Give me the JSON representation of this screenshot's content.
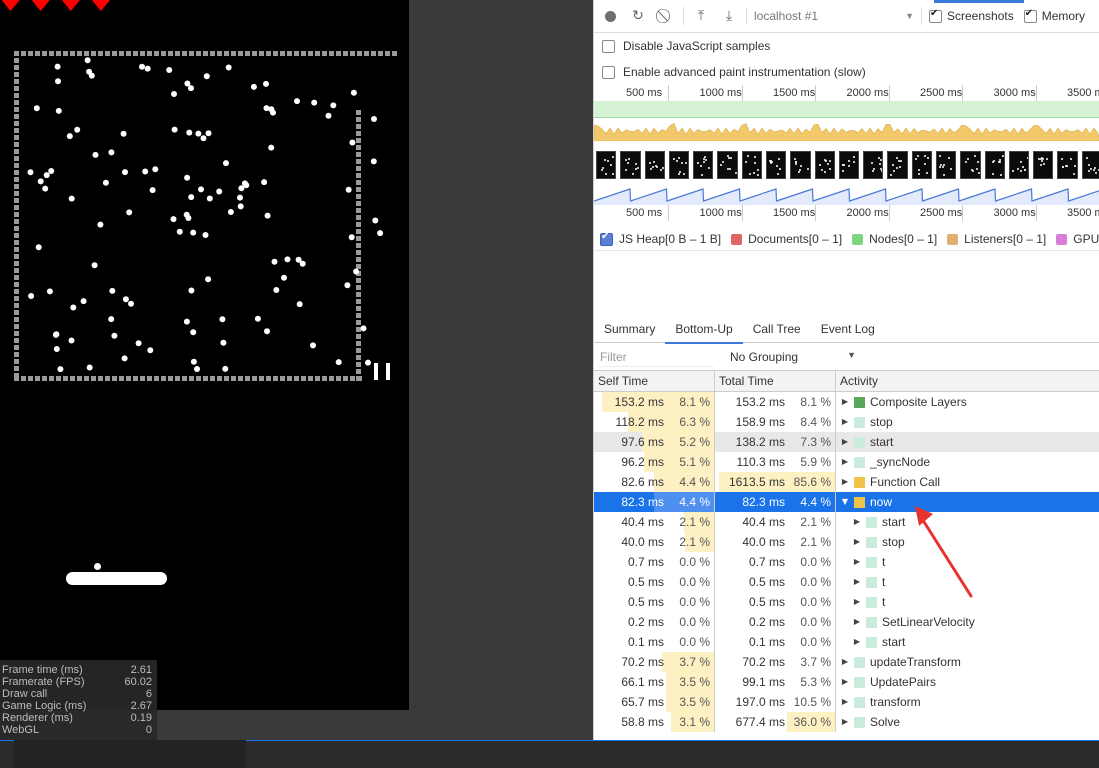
{
  "game": {
    "hearts": [
      "♥",
      "♥",
      "♥",
      "♥"
    ],
    "pause_icon": "pause-icon"
  },
  "stats": [
    {
      "label": "Frame time (ms)",
      "value": "2.61"
    },
    {
      "label": "Framerate (FPS)",
      "value": "60.02"
    },
    {
      "label": "Draw call",
      "value": "6"
    },
    {
      "label": "Game Logic (ms)",
      "value": "2.67"
    },
    {
      "label": "Renderer (ms)",
      "value": "0.19"
    },
    {
      "label": "WebGL",
      "value": "0"
    }
  ],
  "toolbar": {
    "target": "localhost #1",
    "screenshots_label": "Screenshots",
    "memory_label": "Memory"
  },
  "options": {
    "disable_js_samples": "Disable JavaScript samples",
    "advanced_paint": "Enable advanced paint instrumentation (slow)"
  },
  "ruler_labels": [
    "500 ms",
    "1000 ms",
    "1500 ms",
    "2000 ms",
    "2500 ms",
    "3000 ms",
    "3500 ms"
  ],
  "legend": [
    {
      "label": "JS Heap[0 B – 1 B]",
      "color": "#5a7fd6",
      "checked": true
    },
    {
      "label": "Documents[0 – 1]",
      "color": "#e06666",
      "checked": false
    },
    {
      "label": "Nodes[0 – 1]",
      "color": "#7ed67e",
      "checked": false
    },
    {
      "label": "Listeners[0 – 1]",
      "color": "#e0b070",
      "checked": false
    },
    {
      "label": "GPU Memory",
      "color": "#d77ed7",
      "checked": false
    }
  ],
  "tabs": [
    "Summary",
    "Bottom-Up",
    "Call Tree",
    "Event Log"
  ],
  "active_tab": "Bottom-Up",
  "filter": {
    "placeholder": "Filter",
    "grouping": "No Grouping"
  },
  "table": {
    "headers": [
      "Self Time",
      "Total Time",
      "Activity"
    ],
    "rows": [
      {
        "self": "153.2 ms",
        "selfPct": "8.1 %",
        "selfBar": 0.93,
        "total": "153.2 ms",
        "totalPct": "8.1 %",
        "totalBar": 0.0,
        "name": "Composite Layers",
        "color": "#5aa65a",
        "indent": 0,
        "open": false,
        "state": ""
      },
      {
        "self": "118.2 ms",
        "selfPct": "6.3 %",
        "selfBar": 0.72,
        "total": "158.9 ms",
        "totalPct": "8.4 %",
        "totalBar": 0.0,
        "name": "stop",
        "color": "#c9ecdc",
        "indent": 0,
        "open": false,
        "state": ""
      },
      {
        "self": "97.6 ms",
        "selfPct": "5.2 %",
        "selfBar": 0.6,
        "total": "138.2 ms",
        "totalPct": "7.3 %",
        "totalBar": 0.0,
        "name": "start",
        "color": "#c9ecdc",
        "indent": 0,
        "open": false,
        "state": "hover"
      },
      {
        "self": "96.2 ms",
        "selfPct": "5.1 %",
        "selfBar": 0.58,
        "total": "110.3 ms",
        "totalPct": "5.9 %",
        "totalBar": 0.0,
        "name": "_syncNode",
        "color": "#c9ecdc",
        "indent": 0,
        "open": false,
        "state": ""
      },
      {
        "self": "82.6 ms",
        "selfPct": "4.4 %",
        "selfBar": 0.5,
        "total": "1613.5 ms",
        "totalPct": "85.6 %",
        "totalBar": 0.97,
        "name": "Function Call",
        "color": "#f0c24a",
        "indent": 0,
        "open": false,
        "state": ""
      },
      {
        "self": "82.3 ms",
        "selfPct": "4.4 %",
        "selfBar": 0.5,
        "total": "82.3 ms",
        "totalPct": "4.4 %",
        "totalBar": 0.0,
        "name": "now",
        "color": "#f0c24a",
        "indent": 0,
        "open": true,
        "state": "sel"
      },
      {
        "self": "40.4 ms",
        "selfPct": "2.1 %",
        "selfBar": 0.25,
        "total": "40.4 ms",
        "totalPct": "2.1 %",
        "totalBar": 0.0,
        "name": "start",
        "color": "#c9ecdc",
        "indent": 1,
        "open": false,
        "state": ""
      },
      {
        "self": "40.0 ms",
        "selfPct": "2.1 %",
        "selfBar": 0.24,
        "total": "40.0 ms",
        "totalPct": "2.1 %",
        "totalBar": 0.0,
        "name": "stop",
        "color": "#c9ecdc",
        "indent": 1,
        "open": false,
        "state": ""
      },
      {
        "self": "0.7 ms",
        "selfPct": "0.0 %",
        "selfBar": 0.0,
        "total": "0.7 ms",
        "totalPct": "0.0 %",
        "totalBar": 0.0,
        "name": "t",
        "color": "#c9ecdc",
        "indent": 1,
        "open": false,
        "state": ""
      },
      {
        "self": "0.5 ms",
        "selfPct": "0.0 %",
        "selfBar": 0.0,
        "total": "0.5 ms",
        "totalPct": "0.0 %",
        "totalBar": 0.0,
        "name": "t",
        "color": "#c9ecdc",
        "indent": 1,
        "open": false,
        "state": ""
      },
      {
        "self": "0.5 ms",
        "selfPct": "0.0 %",
        "selfBar": 0.0,
        "total": "0.5 ms",
        "totalPct": "0.0 %",
        "totalBar": 0.0,
        "name": "t",
        "color": "#c9ecdc",
        "indent": 1,
        "open": false,
        "state": ""
      },
      {
        "self": "0.2 ms",
        "selfPct": "0.0 %",
        "selfBar": 0.0,
        "total": "0.2 ms",
        "totalPct": "0.0 %",
        "totalBar": 0.0,
        "name": "SetLinearVelocity",
        "color": "#c9ecdc",
        "indent": 1,
        "open": false,
        "state": ""
      },
      {
        "self": "0.1 ms",
        "selfPct": "0.0 %",
        "selfBar": 0.0,
        "total": "0.1 ms",
        "totalPct": "0.0 %",
        "totalBar": 0.0,
        "name": "start",
        "color": "#c9ecdc",
        "indent": 1,
        "open": false,
        "state": ""
      },
      {
        "self": "70.2 ms",
        "selfPct": "3.7 %",
        "selfBar": 0.43,
        "total": "70.2 ms",
        "totalPct": "3.7 %",
        "totalBar": 0.0,
        "name": "updateTransform",
        "color": "#c9ecdc",
        "indent": 0,
        "open": false,
        "state": ""
      },
      {
        "self": "66.1 ms",
        "selfPct": "3.5 %",
        "selfBar": 0.4,
        "total": "99.1 ms",
        "totalPct": "5.3 %",
        "totalBar": 0.0,
        "name": "UpdatePairs",
        "color": "#c9ecdc",
        "indent": 0,
        "open": false,
        "state": ""
      },
      {
        "self": "65.7 ms",
        "selfPct": "3.5 %",
        "selfBar": 0.4,
        "total": "197.0 ms",
        "totalPct": "10.5 %",
        "totalBar": 0.0,
        "name": "transform",
        "color": "#c9ecdc",
        "indent": 0,
        "open": false,
        "state": ""
      },
      {
        "self": "58.8 ms",
        "selfPct": "3.1 %",
        "selfBar": 0.36,
        "total": "677.4 ms",
        "totalPct": "36.0 %",
        "totalBar": 0.4,
        "name": "Solve",
        "color": "#c9ecdc",
        "indent": 0,
        "open": false,
        "state": ""
      }
    ]
  }
}
